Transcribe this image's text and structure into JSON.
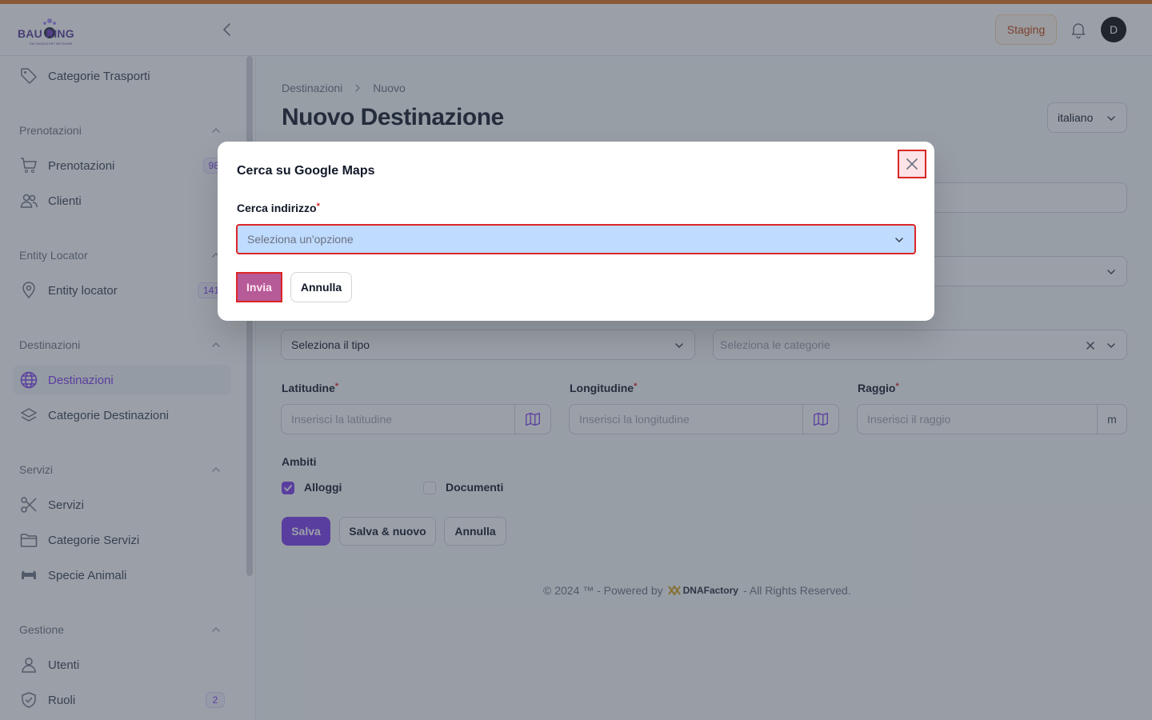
{
  "colors": {
    "accent": "#7c3aed",
    "top_strip": "#e0701a",
    "staging_text": "#c2410c",
    "highlight_red": "#dc2626",
    "select_focus_bg": "#bfdbfe"
  },
  "header": {
    "logo_text": "BAU KING",
    "logo_subtext": "THE WORLD PET NETWORK",
    "collapse_icon": "chevron-left-icon",
    "env_badge": "Staging",
    "bell_icon": "bell-icon",
    "avatar_initial": "D"
  },
  "sidebar": {
    "top_item": {
      "label": "Categorie Trasporti",
      "icon": "tag-icon"
    },
    "groups": [
      {
        "label": "Prenotazioni",
        "items": [
          {
            "label": "Prenotazioni",
            "icon": "cart-icon",
            "badge": "98"
          },
          {
            "label": "Clienti",
            "icon": "users-icon"
          }
        ]
      },
      {
        "label": "Entity Locator",
        "items": [
          {
            "label": "Entity locator",
            "icon": "map-pin-icon",
            "badge": "141"
          }
        ]
      },
      {
        "label": "Destinazioni",
        "items": [
          {
            "label": "Destinazioni",
            "icon": "globe-icon",
            "active": true
          },
          {
            "label": "Categorie Destinazioni",
            "icon": "layers-icon"
          }
        ]
      },
      {
        "label": "Servizi",
        "items": [
          {
            "label": "Servizi",
            "icon": "scissors-icon"
          },
          {
            "label": "Categorie Servizi",
            "icon": "folder-icon"
          },
          {
            "label": "Specie Animali",
            "icon": "animal-icon"
          }
        ]
      },
      {
        "label": "Gestione",
        "items": [
          {
            "label": "Utenti",
            "icon": "user-icon"
          },
          {
            "label": "Ruoli",
            "icon": "shield-icon",
            "badge": "2"
          }
        ]
      }
    ]
  },
  "main": {
    "breadcrumb": [
      "Destinazioni",
      "Nuovo"
    ],
    "title": "Nuovo Destinazione",
    "language_select": "italiano",
    "tipo_select_value": "Seleziona il tipo",
    "categorie_placeholder": "Seleziona le categorie",
    "fields": {
      "latitudine": {
        "label": "Latitudine",
        "placeholder": "Inserisci la latitudine",
        "addon_icon": "map-icon"
      },
      "longitudine": {
        "label": "Longitudine",
        "placeholder": "Inserisci la longitudine",
        "addon_icon": "map-icon"
      },
      "raggio": {
        "label": "Raggio",
        "placeholder": "Inserisci il raggio",
        "addon": "m"
      }
    },
    "ambiti": {
      "label": "Ambiti",
      "options": [
        {
          "label": "Alloggi",
          "checked": true
        },
        {
          "label": "Documenti",
          "checked": false
        }
      ]
    },
    "buttons": {
      "save": "Salva",
      "save_new": "Salva & nuovo",
      "cancel": "Annulla"
    }
  },
  "footer": {
    "left": "© 2024 ™ - Powered by",
    "brand": "DNAFactory",
    "right": "- All Rights Reserved."
  },
  "modal": {
    "title": "Cerca su Google Maps",
    "field_label": "Cerca indirizzo",
    "required_mark": "*",
    "select_placeholder": "Seleziona un'opzione",
    "submit": "Invia",
    "cancel": "Annulla",
    "close_icon": "close-icon"
  }
}
